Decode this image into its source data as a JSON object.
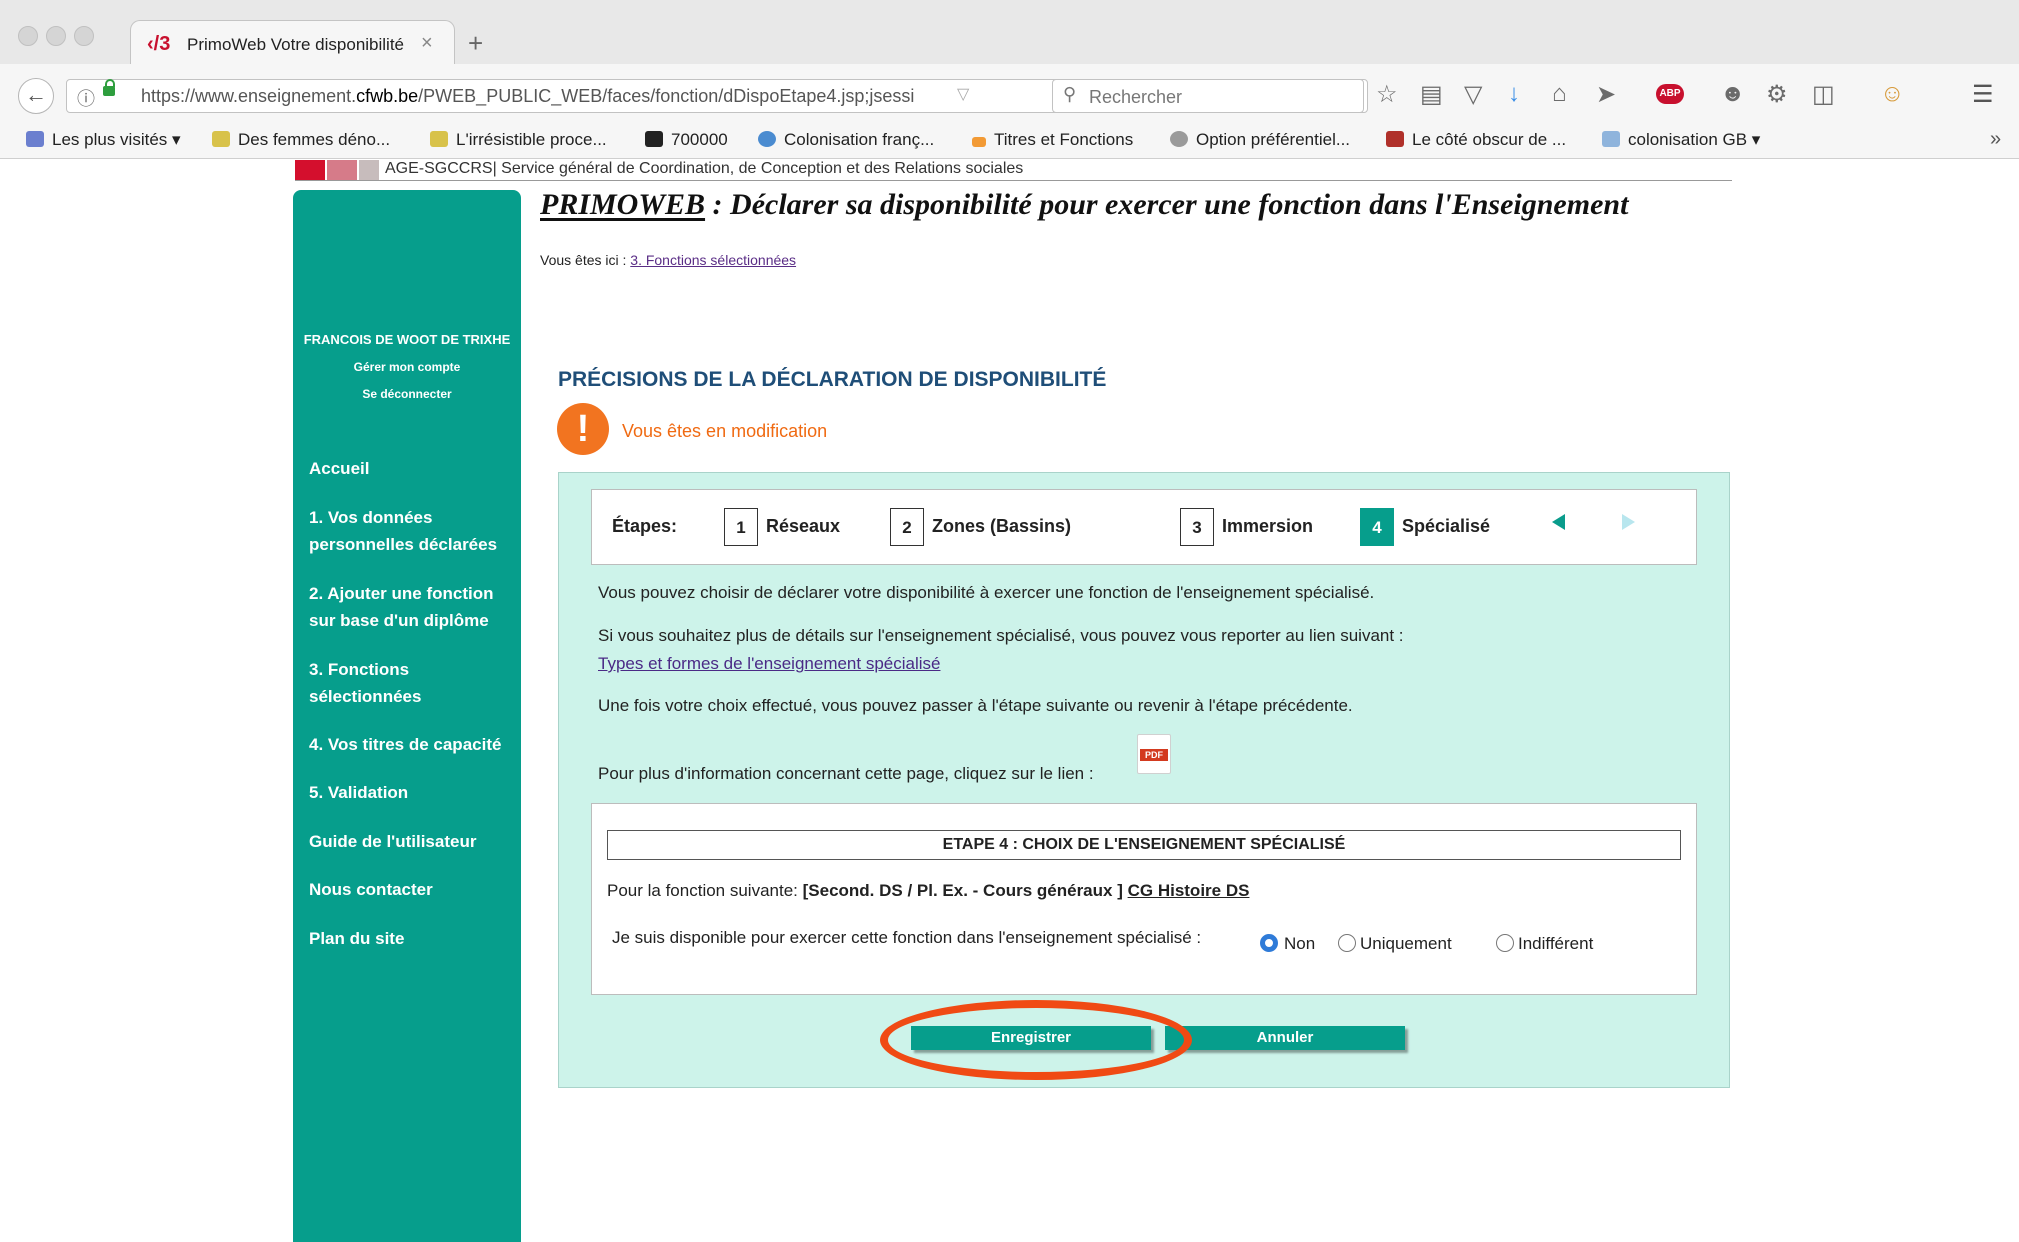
{
  "browser": {
    "tab_title": "PrimoWeb Votre disponibilité",
    "tab_logo": "‹/3",
    "close_glyph": "×",
    "new_tab_glyph": "+",
    "url_prefix": "https://www.enseignement.",
    "url_domain": "cfwb.be",
    "url_path": "/PWEB_PUBLIC_WEB/faces/fonction/dDispoEtape4.jsp;jsessi",
    "search_placeholder": "Rechercher",
    "adblock_label": "ABP",
    "bookmarks": [
      {
        "label": "Les plus visités ▾",
        "color": "#6b7fcf"
      },
      {
        "label": "Des femmes déno...",
        "color": "#d8c24a"
      },
      {
        "label": "L'irrésistible proce...",
        "color": "#d8c24a"
      },
      {
        "label": "700000",
        "color": "#222222"
      },
      {
        "label": "Colonisation franç...",
        "color": "#4a8bd0"
      },
      {
        "label": "Titres et Fonctions",
        "color": "#f29a35"
      },
      {
        "label": "Option préférentiel...",
        "color": "#9a9a9a"
      },
      {
        "label": "Le côté obscur de ...",
        "color": "#b0302a"
      },
      {
        "label": "colonisation GB ▾",
        "color": "#8fb4dc"
      }
    ],
    "overflow_glyph": "»"
  },
  "banner": {
    "text": "AGE-SGCCRS| Service général de Coordination, de Conception et des Relations sociales"
  },
  "sidebar": {
    "user_name": "FRANCOIS DE WOOT DE TRIXHE",
    "manage_account": "Gérer mon compte",
    "logout": "Se déconnecter",
    "items": [
      "Accueil",
      "1. Vos données personnelles déclarées",
      "2. Ajouter une fonction sur base d'un diplôme",
      "3. Fonctions sélectionnées",
      "4. Vos titres de capacité",
      "5. Validation",
      "Guide de l'utilisateur",
      "Nous contacter",
      "Plan du site"
    ]
  },
  "header": {
    "title_brand": "PRIMOWEB",
    "title_rest": " : Déclarer sa disponibilité pour exercer une fonction dans l'Enseignement",
    "breadcrumb_prefix": "Vous êtes ici : ",
    "breadcrumb_link": "3. Fonctions sélectionnées"
  },
  "main": {
    "section_title": "PRÉCISIONS DE LA DÉCLARATION DE DISPONIBILITÉ",
    "warning_glyph": "!",
    "warning_text": "Vous êtes en modification",
    "steps_label": "Étapes:",
    "steps": [
      {
        "num": "1",
        "label": "Réseaux"
      },
      {
        "num": "2",
        "label": "Zones (Bassins)"
      },
      {
        "num": "3",
        "label": "Immersion"
      },
      {
        "num": "4",
        "label": "Spécialisé"
      }
    ],
    "paragraphs": [
      "Vous pouvez choisir de déclarer votre disponibilité à exercer une fonction de l'enseignement spécialisé.",
      "Si vous souhaitez plus de détails sur l'enseignement spécialisé, vous pouvez vous reporter au lien suivant :",
      "Une fois votre choix effectué, vous pouvez passer à l'étape suivante ou revenir à l'étape précédente.",
      "Pour plus d'information concernant cette page, cliquez sur le lien :"
    ],
    "types_link": "Types et formes de l'enseignement spécialisé",
    "pdf_label": "PDF",
    "choice_title": "ETAPE 4 : CHOIX DE L'ENSEIGNEMENT SPÉCIALISÉ",
    "function_prefix": "Pour la fonction suivante: ",
    "function_bold": "[Second. DS / Pl. Ex. - Cours généraux ] ",
    "function_link": "CG Histoire DS",
    "question": "Je suis disponible pour exercer cette fonction dans l'enseignement spécialisé :",
    "options": [
      "Non",
      "Uniquement",
      "Indifférent"
    ],
    "selected_option": "Non",
    "save_label": "Enregistrer",
    "cancel_label": "Annuler"
  },
  "colors": {
    "sidebar": "#069e8c",
    "panel": "#cdf3ea",
    "warning": "#f27420",
    "highlight": "#f04a14",
    "title_blue": "#1f4e78"
  }
}
